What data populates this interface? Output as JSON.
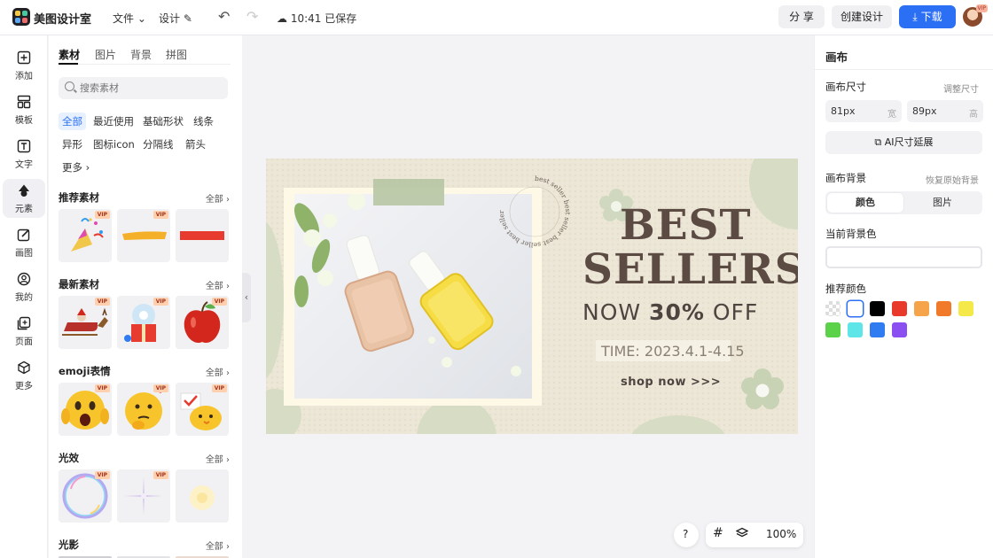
{
  "app": {
    "name": "美图设计室",
    "menu_file": "文件",
    "menu_design": "设计",
    "save_status": "10:41 已保存",
    "share_label": "分 享",
    "create_label": "创建设计",
    "download_label": "下载",
    "avatar_badge": "VIP"
  },
  "rail": [
    {
      "id": "add",
      "label": "添加",
      "icon": "plus-square-icon"
    },
    {
      "id": "template",
      "label": "模板",
      "icon": "layout-icon"
    },
    {
      "id": "text",
      "label": "文字",
      "icon": "text-icon"
    },
    {
      "id": "element",
      "label": "元素",
      "icon": "shapes-icon"
    },
    {
      "id": "draw",
      "label": "画图",
      "icon": "edit-icon"
    },
    {
      "id": "mine",
      "label": "我的",
      "icon": "user-icon"
    },
    {
      "id": "page",
      "label": "页面",
      "icon": "add-page-icon"
    },
    {
      "id": "more",
      "label": "更多",
      "icon": "cube-icon"
    }
  ],
  "panel": {
    "tabs": [
      "素材",
      "图片",
      "背景",
      "拼图"
    ],
    "search_placeholder": "搜索素材",
    "chips": [
      "全部",
      "最近使用",
      "基础形状",
      "线条",
      "异形",
      "图标icon",
      "分隔线",
      "箭头",
      "更多"
    ],
    "sections": [
      {
        "title": "推荐素材",
        "more": "全部"
      },
      {
        "title": "最新素材",
        "more": "全部"
      },
      {
        "title": "emoji表情",
        "more": "全部"
      },
      {
        "title": "光效",
        "more": "全部"
      },
      {
        "title": "光影",
        "more": "全部"
      }
    ],
    "vip_label": "VIP",
    "colors": {
      "party": "#f1c74a",
      "bar_yellow": "#f5b02a",
      "bar_red": "#e63b2e",
      "apple": "#d3261c"
    }
  },
  "canvas": {
    "badge_text": "best seller best seller best seller best seller",
    "headline_1": "BEST",
    "headline_2": "SELLERS",
    "offer_prefix": "NOW ",
    "offer_pct": "30%",
    "offer_suffix": " OFF",
    "time_text": "TIME: 2023.4.1-4.15",
    "cta": "shop now >>>",
    "bg": "#ece6d6",
    "accent": "#5b4b43"
  },
  "controls": {
    "help": "?",
    "zoom": "100%"
  },
  "inspector": {
    "title": "画布",
    "size_label": "画布尺寸",
    "resize_link": "调整尺寸",
    "width_value": "81px",
    "width_unit": "宽",
    "height_value": "89px",
    "height_unit": "高",
    "ai_extend": "AI尺寸延展",
    "bg_label": "画布背景",
    "restore_link": "恢复原始背景",
    "seg_color": "颜色",
    "seg_image": "图片",
    "current_bg_label": "当前背景色",
    "recommended_label": "推荐颜色",
    "swatches": [
      "transparent",
      "#ffffff",
      "#000000",
      "#e8392a",
      "#f5a44a",
      "#f07a2a",
      "#f5e94a",
      "#5cd14a",
      "#5ee5e8",
      "#2f7cf0",
      "#8b4ef0"
    ]
  }
}
